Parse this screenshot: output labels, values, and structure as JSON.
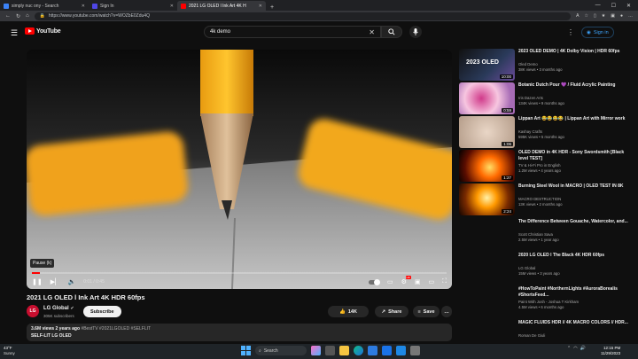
{
  "browser": {
    "tabs": [
      {
        "label": "simply nuc ony - Search",
        "favicon_color": "#3b82f6"
      },
      {
        "label": "Sign In",
        "favicon_color": "#4f46e5"
      },
      {
        "label": "2021 LG OLED l Ink Art 4K H",
        "favicon_color": "#ff0000",
        "active": true
      }
    ],
    "new_tab": "+",
    "url": "https://www.youtube.com/watch?v=WOZbE0Zdu4Q"
  },
  "youtube": {
    "logo_text": "YouTube",
    "search_value": "4k demo",
    "sign_in": "Sign in"
  },
  "player": {
    "tooltip": "Pause (k)",
    "time": "0:01 / 0:45",
    "progress": 0.02
  },
  "video": {
    "title": "2021 LG OLED l Ink Art 4K HDR 60fps",
    "channel": "LG Global",
    "subscribers": "305K subscribers",
    "subscribe_label": "Subscribe",
    "likes": "14K",
    "share_label": "Share",
    "save_label": "Save",
    "views_age": "3.6M views  2 years ago",
    "tags": "#BestTV #2021LGOLED #SELFLIT",
    "desc_line": "SELF-LIT LG OLED"
  },
  "recommendations": [
    {
      "title": "2023 OLED DEMO | 4K Dolby Vision | HDR 60fps",
      "channel": "Oled Demo",
      "meta": "38K views • 3 months ago",
      "duration": "10:00",
      "thumb": "oled"
    },
    {
      "title": "Botanic Dutch Pour 💜 / Fluid Acrylic Painting",
      "channel": "Iris Dazen Arts",
      "meta": "134K views • 9 months ago",
      "duration": "0:59",
      "thumb": "pink"
    },
    {
      "title": "Lippan Art 😂😂😂😂 | Lippan Art with Mirror work",
      "channel": "Kashay Crafts",
      "meta": "595K views • 5 months ago",
      "duration": "1:06",
      "thumb": "beige"
    },
    {
      "title": "OLED DEMO in 4K HDR - Sony Swordsmith [Black level TEST]",
      "channel": "TV & Hi-Fi Pro in English",
      "meta": "1.2M views • 4 years ago",
      "duration": "1:27",
      "thumb": "fire"
    },
    {
      "title": "Burning Steel Wool in MACRO | OLED TEST IN 8K",
      "channel": "MACRO DESTRUCTION",
      "meta": "13K views • 2 months ago",
      "duration": "2:24",
      "thumb": "spark"
    },
    {
      "title": "The Difference Between Gouache, Watercolor, and...",
      "channel": "Scott Christian Sava",
      "meta": "2.5M views • 1 year ago"
    },
    {
      "title": "2020 LG OLED l The Black 4K HDR 60fps",
      "channel": "LG Global",
      "meta": "15M views • 3 years ago"
    },
    {
      "title": "#HowToPaint #NorthernLights #AuroraBorealis #ShortsFeed...",
      "channel": "Paint With Josh - Joshua T Kirkham",
      "meta": "4.5M views • 6 months ago"
    },
    {
      "title": "MAGIC FLUIDS HDR // 4K MACRO COLORS // HDR...",
      "channel": "Roman De Giuli",
      "meta": ""
    }
  ],
  "taskbar": {
    "temperature": "43°F",
    "weather": "Sunny",
    "search": "Search",
    "time": "12:15 PM",
    "date": "11/29/2023"
  },
  "colors": {
    "youtube_red": "#ff0000",
    "accent_blue": "#3ea6ff",
    "background": "#0f0f0f"
  }
}
